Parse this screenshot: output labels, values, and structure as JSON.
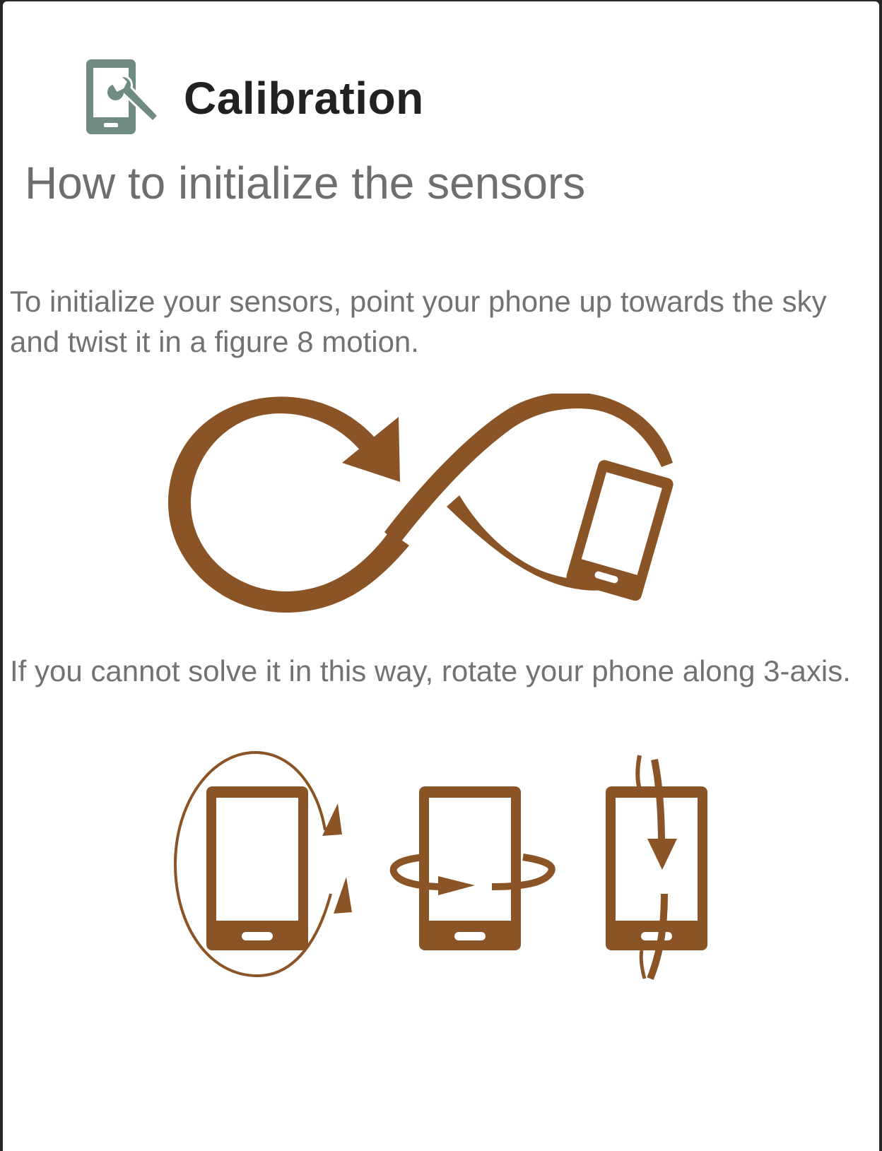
{
  "dialog": {
    "title": "Calibration",
    "app_icon": "phone-wrench-icon",
    "heading": "How to initialize the sensors",
    "instruction_primary": "To initialize your sensors, point your phone up towards the sky and twist it in a figure 8 motion.",
    "instruction_fallback": "If you cannot solve it in this way, rotate your phone along 3-axis."
  },
  "illustrations": {
    "figure_eight": "figure-eight-motion-illustration",
    "three_axis": [
      "rotate-z-axis-illustration",
      "rotate-y-axis-illustration",
      "rotate-x-axis-illustration"
    ]
  },
  "colors": {
    "accent": "#8B5426",
    "icon": "#6F8B82",
    "title": "#212121",
    "text": "#727272"
  }
}
